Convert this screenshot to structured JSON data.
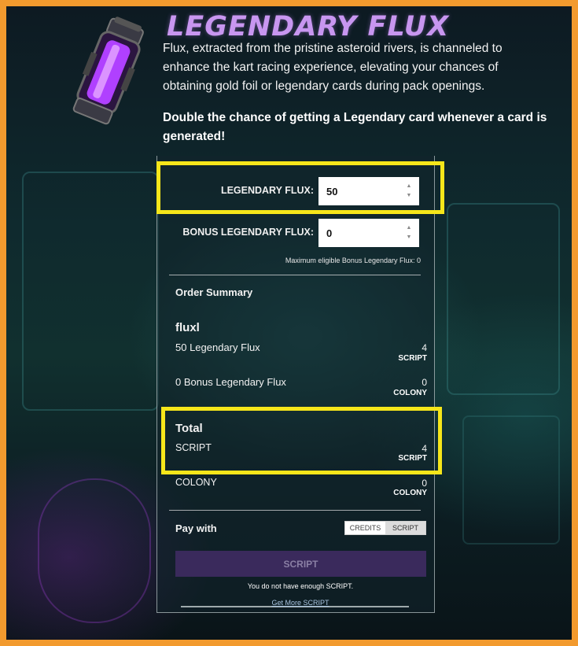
{
  "header": {
    "title": "LEGENDARY FLUX",
    "description": "Flux, extracted from the pristine asteroid rivers, is channeled to enhance the kart racing experience, elevating your chances of obtaining gold foil or legendary cards during pack openings.",
    "subheading": "Double the chance of getting a Legendary card whenever a card is generated!",
    "image_icon": "flux-vial-icon"
  },
  "form": {
    "legendary_flux": {
      "label": "LEGENDARY FLUX:",
      "value": "50"
    },
    "bonus_legendary_flux": {
      "label": "BONUS LEGENDARY FLUX:",
      "value": "0"
    },
    "helper": "Maximum eligible Bonus Legendary Flux: 0"
  },
  "summary": {
    "heading": "Order Summary",
    "username": "fluxl",
    "lines": [
      {
        "label": "50 Legendary Flux",
        "amount": "4",
        "currency": "SCRIPT"
      },
      {
        "label": "0 Bonus Legendary Flux",
        "amount": "0",
        "currency": "COLONY"
      }
    ],
    "total_heading": "Total",
    "totals": [
      {
        "label": "SCRIPT",
        "amount": "4",
        "currency": "SCRIPT"
      },
      {
        "label": "COLONY",
        "amount": "0",
        "currency": "COLONY"
      }
    ]
  },
  "payment": {
    "label": "Pay with",
    "options": [
      "CREDITS",
      "SCRIPT"
    ],
    "selected": "SCRIPT",
    "button_label": "SCRIPT",
    "notice": "You do not have enough SCRIPT.",
    "link": "Get More SCRIPT"
  },
  "colors": {
    "border": "#f29a2e",
    "highlight": "#f6e61a",
    "title": "#c896f0",
    "pay_button": "#3a2a5c"
  }
}
